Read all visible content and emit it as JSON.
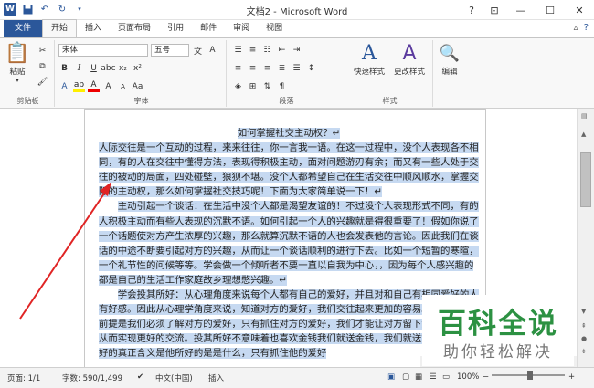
{
  "window": {
    "title": "文档2 - Microsoft Word"
  },
  "qat": {
    "word_icon": "W"
  },
  "tabs": [
    "文件",
    "开始",
    "插入",
    "页面布局",
    "引用",
    "邮件",
    "审阅",
    "视图"
  ],
  "ribbon": {
    "clipboard": {
      "paste": "粘贴",
      "label": "剪贴板"
    },
    "font": {
      "name": "宋体",
      "size": "五号",
      "label": "字体"
    },
    "paragraph": {
      "label": "段落"
    },
    "styles": {
      "quick": "快速样式",
      "change": "更改样式",
      "label": "样式"
    },
    "editing": {
      "label": "编辑"
    }
  },
  "document": {
    "title": "如何掌握社交主动权？",
    "paragraphs": [
      "人际交往是一个互动的过程，来来往往，你一言我一语。在这一过程中，没个人表现各不相同，有的人在交往中懂得方法，表现得积极主动，面对问题游刃有余；而又有一些人处于交往的被动的局面，四处碰壁，狼狈不堪。没个人都希望自己在生活交往中顺风顺水，掌握交际的主动权，那么如何掌握社交技巧呢！下面为大家简单说一下！",
      "主动引起一个谈话：在生活中没个人都是渴望友谊的！不过没个人表现形式不同，有的人积极主动而有些人表现的沉默不语。如何引起一个人的兴趣就是得很重要了！假如你说了一个话题使对方产生浓厚的兴趣，那么就算沉默不语的人也会发表他的言论。因此我们在谈话的中途不断要引起对方的兴趣，从而让一个谈话顺利的进行下去。比如一个短暂的寒暄，一个礼节性的问候等等。学会做一个倾听者不要一直以自我为中心，，因为每个人感兴趣的都是自己的生活工作家庭故乡理想憋兴趣。",
      "学会投其所好：从心理角度来说每个人都有自己的爱好，并且对和自己有相同爱好的人有好感。因此从心理学角度来说，知道对方的爱好，我们交往起来更加的容易。投其所好的前提是我们必须了解对方的爱好，只有抓住对方的爱好，我们才能让对方留下深刻的印象，从而实现更好的交流。投其所好不意味着也喜欢金钱我们就送金钱，我们就送古董，投其所好的真正含义是他所好的是是什么，只有抓住他的爱好"
    ]
  },
  "status": {
    "page": "页面: 1/1",
    "words": "字数: 590/1,499",
    "language": "中文(中国)",
    "mode": "插入",
    "zoom": "100%"
  },
  "watermark": {
    "title": "百科全说",
    "subtitle": "助你轻松解决"
  }
}
